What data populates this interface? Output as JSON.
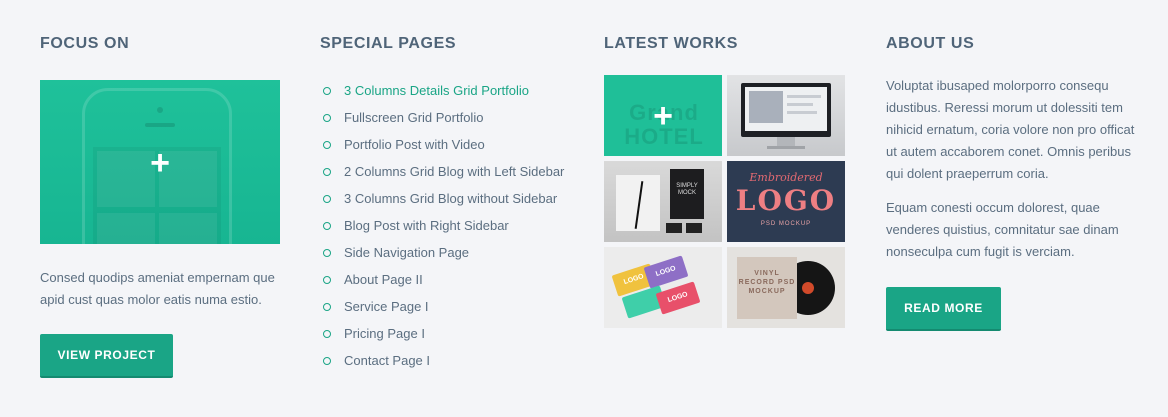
{
  "focus": {
    "heading": "FOCUS ON",
    "description": "Consed quodips ameniat empernam que apid cust quas molor eatis numa estio.",
    "button_label": "VIEW PROJECT",
    "thumb_overlay_icon": "plus-icon"
  },
  "special": {
    "heading": "SPECIAL PAGES",
    "items": [
      {
        "label": "3 Columns Details Grid Portfolio",
        "active": true
      },
      {
        "label": "Fullscreen Grid Portfolio",
        "active": false
      },
      {
        "label": "Portfolio Post with Video",
        "active": false
      },
      {
        "label": "2 Columns Grid Blog with Left Sidebar",
        "active": false
      },
      {
        "label": "3 Columns Grid Blog without Sidebar",
        "active": false
      },
      {
        "label": "Blog Post with Right Sidebar",
        "active": false
      },
      {
        "label": "Side Navigation Page",
        "active": false
      },
      {
        "label": "About Page II",
        "active": false
      },
      {
        "label": "Service Page I",
        "active": false
      },
      {
        "label": "Pricing Page I",
        "active": false
      },
      {
        "label": "Contact Page I",
        "active": false
      }
    ]
  },
  "works": {
    "heading": "LATEST WORKS",
    "thumbs": {
      "hotel": "Grand HOTEL",
      "stationery": "SIMPLY MOCK",
      "embroidered_script": "Embroidered",
      "embroidered_logo": "LOGO",
      "embroidered_sub": "PSD MOCKUP",
      "card_label": "LOGO",
      "vinyl": "VINYL RECORD PSD MOCKUP"
    }
  },
  "about": {
    "heading": "ABOUT US",
    "paragraph_1": "Voluptat ibusaped molorporro consequ idustibus. Reressi morum ut dolessiti tem nihicid ernatum, coria volore non pro officat ut autem accaborem conet. Omnis peribus qui dolent praeperrum coria.",
    "paragraph_2": "Equam conesti occum dolorest, quae venderes quistius, comnitatur sae dinam nonseculpa cum fugit is verciam.",
    "button_label": "READ MORE"
  },
  "colors": {
    "accent": "#1aa586",
    "background": "#f4f5f8",
    "heading": "#4f6478",
    "text": "#5b6e80"
  }
}
